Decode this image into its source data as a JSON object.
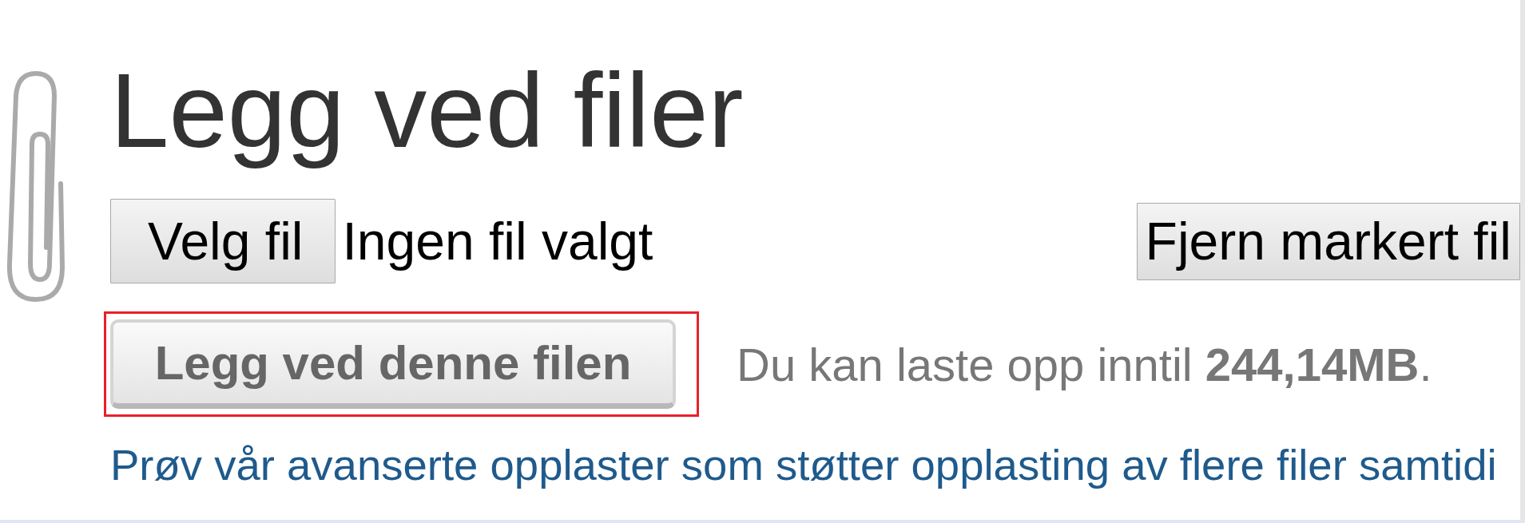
{
  "title": "Legg ved filer",
  "file_picker": {
    "button": "Velg fil",
    "status": "Ingen fil valgt"
  },
  "remove_button": {
    "label": "Fjern markert fil"
  },
  "upload_button": {
    "label": "Legg ved denne filen",
    "highlighted": true
  },
  "limit_text": "Du kan laste opp inntil **244,14MB**.",
  "advanced_link": "Prøv vår avanserte opplaster som støtter opplasting av flere filer samtidi"
}
